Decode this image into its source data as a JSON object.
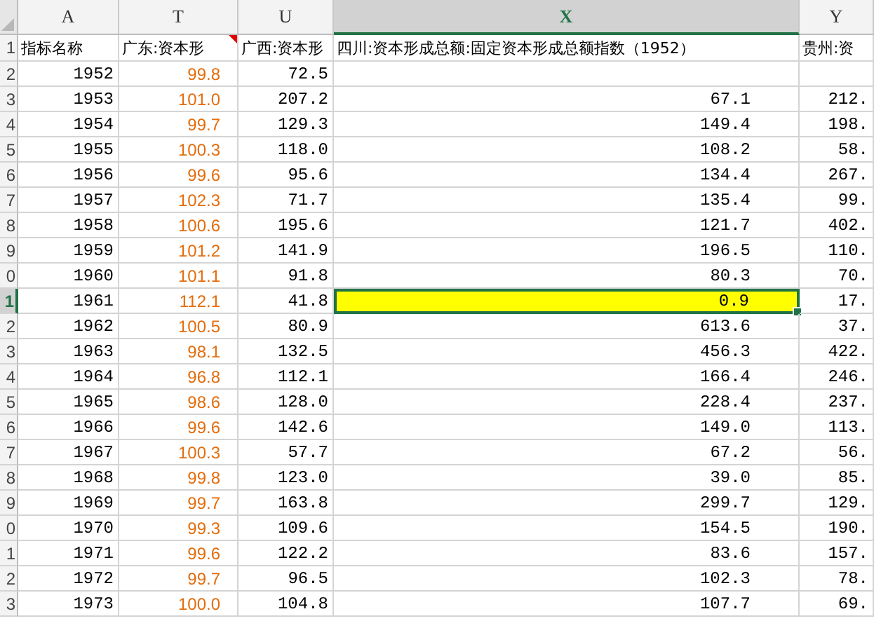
{
  "columns": [
    {
      "label": "A",
      "selected": false
    },
    {
      "label": "T",
      "selected": false
    },
    {
      "label": "U",
      "selected": false
    },
    {
      "label": "X",
      "selected": true
    },
    {
      "label": "Y",
      "selected": false
    }
  ],
  "header_row": {
    "row_number": "1",
    "cells": [
      {
        "text": "指标名称",
        "comment": false
      },
      {
        "text": "广东:资本形",
        "comment": true
      },
      {
        "text": "广西:资本形",
        "comment": false
      },
      {
        "text": "四川:资本形成总额:固定资本形成总额指数（1952）",
        "comment": false
      },
      {
        "text": "贵州:资",
        "comment": false
      }
    ]
  },
  "rows": [
    {
      "row_number": "2",
      "selected": false,
      "cells": [
        "1952",
        "99.8",
        "72.5",
        "",
        ""
      ]
    },
    {
      "row_number": "3",
      "selected": false,
      "cells": [
        "1953",
        "101.0",
        "207.2",
        "67.1",
        "212."
      ]
    },
    {
      "row_number": "4",
      "selected": false,
      "cells": [
        "1954",
        "99.7",
        "129.3",
        "149.4",
        "198."
      ]
    },
    {
      "row_number": "5",
      "selected": false,
      "cells": [
        "1955",
        "100.3",
        "118.0",
        "108.2",
        "58."
      ]
    },
    {
      "row_number": "6",
      "selected": false,
      "cells": [
        "1956",
        "99.6",
        "95.6",
        "134.4",
        "267."
      ]
    },
    {
      "row_number": "7",
      "selected": false,
      "cells": [
        "1957",
        "102.3",
        "71.7",
        "135.4",
        "99."
      ]
    },
    {
      "row_number": "8",
      "selected": false,
      "cells": [
        "1958",
        "100.6",
        "195.6",
        "121.7",
        "402."
      ]
    },
    {
      "row_number": "9",
      "selected": false,
      "cells": [
        "1959",
        "101.2",
        "141.9",
        "196.5",
        "110."
      ]
    },
    {
      "row_number": "0",
      "selected": false,
      "cells": [
        "1960",
        "101.1",
        "91.8",
        "80.3",
        "70."
      ]
    },
    {
      "row_number": "1",
      "selected": true,
      "cells": [
        "1961",
        "112.1",
        "41.8",
        "0.9",
        "17."
      ]
    },
    {
      "row_number": "2",
      "selected": false,
      "cells": [
        "1962",
        "100.5",
        "80.9",
        "613.6",
        "37."
      ]
    },
    {
      "row_number": "3",
      "selected": false,
      "cells": [
        "1963",
        "98.1",
        "132.5",
        "456.3",
        "422."
      ]
    },
    {
      "row_number": "4",
      "selected": false,
      "cells": [
        "1964",
        "96.8",
        "112.1",
        "166.4",
        "246."
      ]
    },
    {
      "row_number": "5",
      "selected": false,
      "cells": [
        "1965",
        "98.6",
        "128.0",
        "228.4",
        "237."
      ]
    },
    {
      "row_number": "6",
      "selected": false,
      "cells": [
        "1966",
        "99.6",
        "142.6",
        "149.0",
        "113."
      ]
    },
    {
      "row_number": "7",
      "selected": false,
      "cells": [
        "1967",
        "100.3",
        "57.7",
        "67.2",
        "56."
      ]
    },
    {
      "row_number": "8",
      "selected": false,
      "cells": [
        "1968",
        "99.8",
        "123.0",
        "39.0",
        "85."
      ]
    },
    {
      "row_number": "9",
      "selected": false,
      "cells": [
        "1969",
        "99.7",
        "163.8",
        "299.7",
        "129."
      ]
    },
    {
      "row_number": "0",
      "selected": false,
      "cells": [
        "1970",
        "99.3",
        "109.6",
        "154.5",
        "190."
      ]
    },
    {
      "row_number": "1",
      "selected": false,
      "cells": [
        "1971",
        "99.6",
        "122.2",
        "83.6",
        "157."
      ]
    },
    {
      "row_number": "2",
      "selected": false,
      "cells": [
        "1972",
        "99.7",
        "96.5",
        "102.3",
        "78."
      ]
    },
    {
      "row_number": "3",
      "selected": false,
      "cells": [
        "1973",
        "100.0",
        "104.8",
        "107.7",
        "69."
      ]
    }
  ]
}
